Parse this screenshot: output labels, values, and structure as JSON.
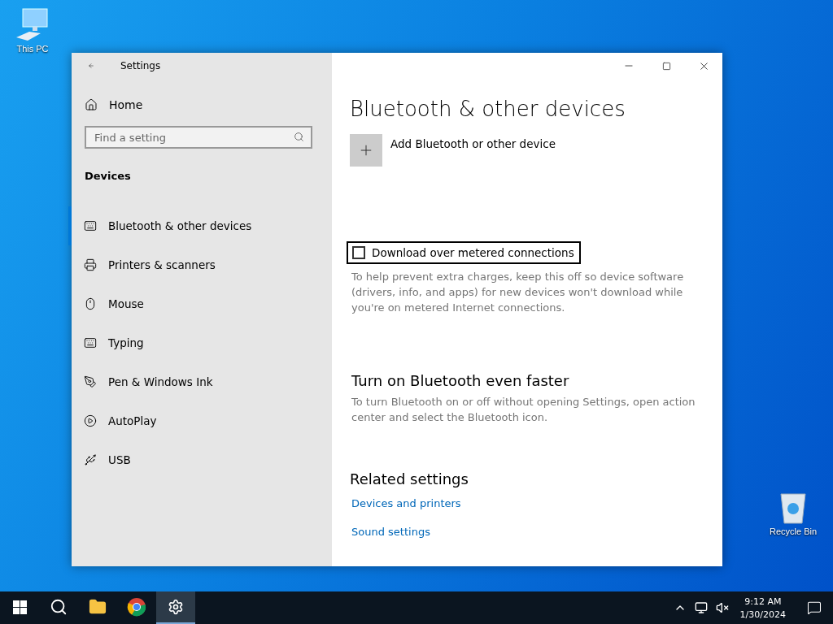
{
  "desktop_icons": [
    {
      "label": "This PC",
      "kind": "pc"
    },
    {
      "label": "Recycle Bin",
      "kind": "bin"
    }
  ],
  "window": {
    "title": "Settings"
  },
  "sidebar": {
    "home": "Home",
    "search": {
      "placeholder": "Find a setting"
    },
    "section": "Devices",
    "items": [
      {
        "label": "Bluetooth & other devices",
        "kind": "bluetooth",
        "selected": true
      },
      {
        "label": "Printers & scanners",
        "kind": "printer",
        "selected": false
      },
      {
        "label": "Mouse",
        "kind": "mouse",
        "selected": false
      },
      {
        "label": "Typing",
        "kind": "typing",
        "selected": false
      },
      {
        "label": "Pen & Windows Ink",
        "kind": "pen",
        "selected": false
      },
      {
        "label": "AutoPlay",
        "kind": "autoplay",
        "selected": false
      },
      {
        "label": "USB",
        "kind": "usb",
        "selected": false
      }
    ]
  },
  "content": {
    "title": "Bluetooth & other devices",
    "add_device": "Add Bluetooth or other device",
    "metered": {
      "label": "Download over metered connections",
      "checked": false,
      "description": "To help prevent extra charges, keep this off so device software (drivers, info, and apps) for new devices won't download while you're on metered Internet connections."
    },
    "faster": {
      "heading": "Turn on Bluetooth even faster",
      "description": "To turn Bluetooth on or off without opening Settings, open action center and select the Bluetooth icon."
    },
    "related": {
      "heading": "Related settings",
      "links": [
        "Devices and printers",
        "Sound settings"
      ]
    }
  },
  "taskbar": {
    "apps": [
      {
        "kind": "explorer",
        "selected": false
      },
      {
        "kind": "chrome",
        "selected": false
      },
      {
        "kind": "settings",
        "selected": true
      }
    ],
    "time": "9:12 AM",
    "date": "1/30/2024"
  }
}
